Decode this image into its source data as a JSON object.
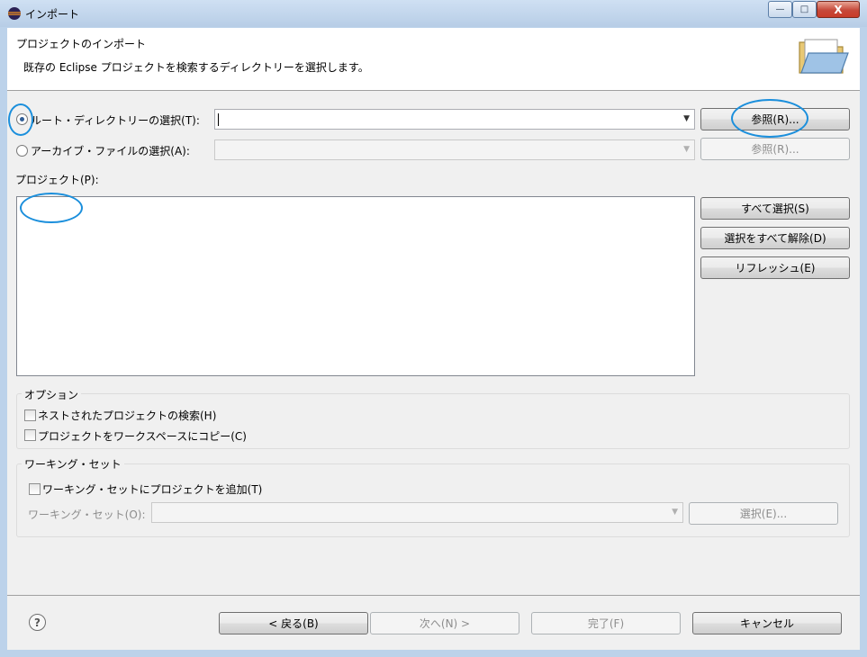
{
  "window": {
    "title": "インポート",
    "controls": {
      "minimize": "—",
      "maximize": "□",
      "close": "X"
    }
  },
  "header": {
    "title": "プロジェクトのインポート",
    "description": "既存の Eclipse プロジェクトを検索するディレクトリーを選択します。"
  },
  "source": {
    "root_dir": {
      "label": "ルート・ディレクトリーの選択(T):",
      "selected": true,
      "value": ""
    },
    "archive": {
      "label": "アーカイブ・ファイルの選択(A):",
      "selected": false,
      "value": ""
    },
    "browse_label": "参照(R)...",
    "browse_disabled_label": "参照(R)..."
  },
  "projects": {
    "label": "プロジェクト(P):",
    "items": [],
    "select_all": "すべて選択(S)",
    "deselect_all": "選択をすべて解除(D)",
    "refresh": "リフレッシュ(E)"
  },
  "options": {
    "label": "オプション",
    "search_nested": "ネストされたプロジェクトの検索(H)",
    "copy_to_workspace": "プロジェクトをワークスペースにコピー(C)"
  },
  "working_set": {
    "label": "ワーキング・セット",
    "add_checkbox": "ワーキング・セットにプロジェクトを追加(T)",
    "field_label": "ワーキング・セット(O):",
    "select_button": "選択(E)..."
  },
  "footer": {
    "help_icon": "?",
    "back": "< 戻る(B)",
    "next": "次へ(N) >",
    "finish": "完了(F)",
    "cancel": "キャンセル"
  },
  "colors": {
    "annotation": "#1b8fdc",
    "radio_dot": "#2f5d96"
  }
}
